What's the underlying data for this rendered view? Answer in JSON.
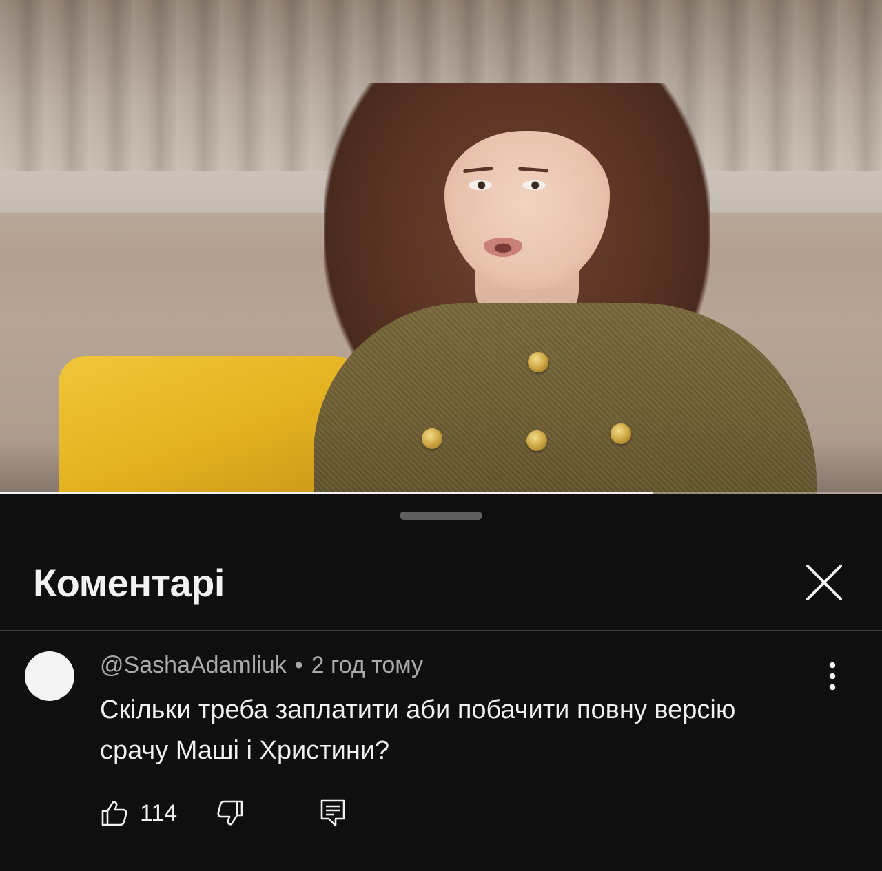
{
  "video": {
    "progress": 0.74
  },
  "comments_panel": {
    "title": "Коментарі",
    "close_icon": "close-icon"
  },
  "comment": {
    "author": "@SashaAdamliuk",
    "separator": "•",
    "time": "2 год тому",
    "text": "Скільки треба заплатити аби побачити повну версію срачу Маші і Христини?",
    "likes": "114",
    "icons": {
      "more": "more-vert-icon",
      "like": "thumb-up-icon",
      "dislike": "thumb-down-icon",
      "reply": "reply-icon"
    }
  },
  "colors": {
    "background": "#0f0f0f",
    "text_primary": "#f1f1f1",
    "text_secondary": "#aaaaaa"
  }
}
